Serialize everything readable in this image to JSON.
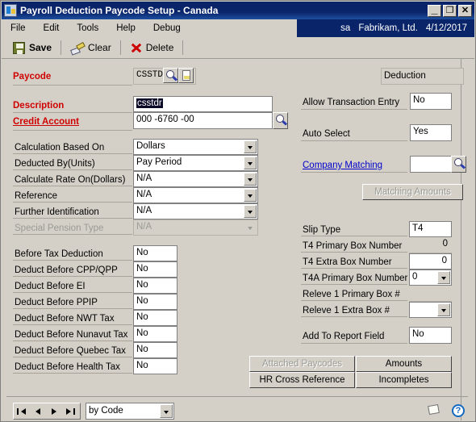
{
  "window": {
    "title": "Payroll Deduction Paycode Setup - Canada",
    "icon": "app-window-icon",
    "minimize": "_",
    "maximize": "❐",
    "close": "✕"
  },
  "menu": {
    "items": [
      "File",
      "Edit",
      "Tools",
      "Help",
      "Debug"
    ],
    "user": "sa",
    "company": "Fabrikam, Ltd.",
    "date": "4/12/2017"
  },
  "toolbar": {
    "save": "Save",
    "clear": "Clear",
    "delete": "Delete"
  },
  "header": {
    "paycode_label": "Paycode",
    "paycode_value": "CSSTDR",
    "type_badge": "Deduction"
  },
  "left": {
    "description_label": "Description",
    "description_value": "csstdr",
    "credit_account_label": "Credit Account",
    "credit_account_value": "000 -6760 -00",
    "dropdowns": [
      {
        "label": "Calculation Based On",
        "value": "Dollars",
        "disabled": false
      },
      {
        "label": "Deducted By(Units)",
        "value": "Pay Period",
        "disabled": false
      },
      {
        "label": "Calculate Rate On(Dollars)",
        "value": "N/A",
        "disabled": false
      },
      {
        "label": "Reference",
        "value": "N/A",
        "disabled": false
      },
      {
        "label": "Further Identification",
        "value": "N/A",
        "disabled": false
      },
      {
        "label": "Special Pension Type",
        "value": "N/A",
        "disabled": true
      }
    ],
    "tax_rows": [
      {
        "label": "Before Tax Deduction",
        "value": "No"
      },
      {
        "label": "Deduct Before CPP/QPP",
        "value": "No"
      },
      {
        "label": "Deduct Before EI",
        "value": "No"
      },
      {
        "label": "Deduct Before PPIP",
        "value": "No"
      },
      {
        "label": "Deduct Before NWT Tax",
        "value": "No"
      },
      {
        "label": "Deduct Before Nunavut Tax",
        "value": "No"
      },
      {
        "label": "Deduct Before Quebec Tax",
        "value": "No"
      },
      {
        "label": "Deduct Before Health Tax",
        "value": "No"
      }
    ]
  },
  "right": {
    "allow_transaction_entry_label": "Allow Transaction Entry",
    "allow_transaction_entry_value": "No",
    "auto_select_label": "Auto Select",
    "auto_select_value": "Yes",
    "company_matching_label": "Company Matching",
    "company_matching_value": "",
    "matching_amounts_button": "Matching Amounts",
    "slip_rows": [
      {
        "label": "Slip Type",
        "value": "T4",
        "kind": "text"
      },
      {
        "label": "T4 Primary Box Number",
        "value": "0",
        "kind": "readonly"
      },
      {
        "label": "T4 Extra Box Number",
        "value": "0",
        "kind": "text"
      },
      {
        "label": "T4A Primary Box Number",
        "value": "0",
        "kind": "combo"
      },
      {
        "label": "Releve 1 Primary Box #",
        "value": "",
        "kind": "readonly"
      },
      {
        "label": "Releve 1 Extra Box #",
        "value": "",
        "kind": "combo"
      }
    ],
    "add_to_report_label": "Add To Report Field",
    "add_to_report_value": "No",
    "buttons": [
      {
        "label": "Attached Paycodes",
        "disabled": true
      },
      {
        "label": "Amounts",
        "disabled": false
      },
      {
        "label": "HR Cross Reference",
        "disabled": false
      },
      {
        "label": "Incompletes",
        "disabled": false
      }
    ]
  },
  "footer": {
    "nav_first": "first-record",
    "nav_prev": "previous-record",
    "nav_next": "next-record",
    "nav_last": "last-record",
    "sort_value": "by Code",
    "note_icon": "note-icon",
    "help_icon": "?"
  }
}
